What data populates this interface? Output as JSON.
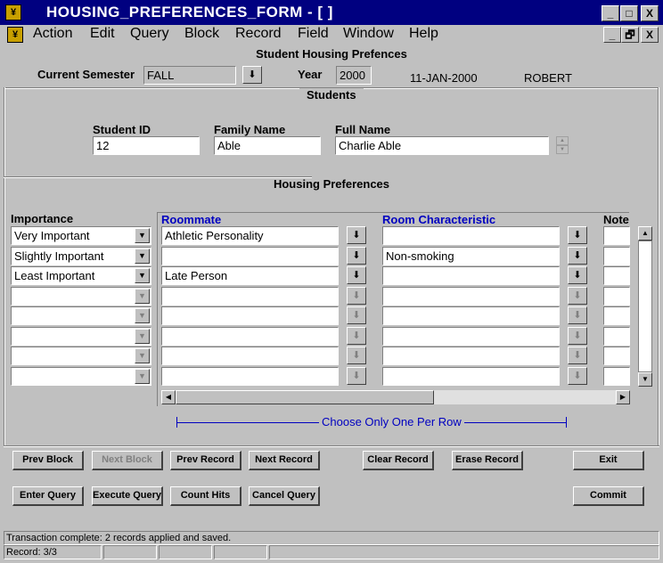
{
  "window": {
    "title": "HOUSING_PREFERENCES_FORM - [ ]",
    "icon": "oracle-forms-icon",
    "controls": {
      "minimize": "_",
      "maximize": "□",
      "close": "X",
      "restore": "🗗"
    }
  },
  "menu": [
    "Action",
    "Edit",
    "Query",
    "Block",
    "Record",
    "Field",
    "Window",
    "Help"
  ],
  "header": {
    "title": "Student Housing Prefences",
    "semester_label": "Current Semester",
    "semester_value": "FALL",
    "year_label": "Year",
    "year_value": "2000",
    "date": "11-JAN-2000",
    "user": "ROBERT"
  },
  "students": {
    "title": "Students",
    "id_label": "Student ID",
    "id_value": "12",
    "family_label": "Family Name",
    "family_value": "Able",
    "full_label": "Full Name",
    "full_value": "Charlie  Able"
  },
  "prefs": {
    "title": "Housing Preferences",
    "importance_label": "Importance",
    "roommate_label": "Roommate",
    "room_label": "Room Characteristic",
    "note_label": "Note",
    "rows": [
      {
        "importance": "Very Important",
        "roommate": "Athletic Personality",
        "room": ""
      },
      {
        "importance": "Slightly Important",
        "roommate": "",
        "room": "Non-smoking"
      },
      {
        "importance": "Least Important",
        "roommate": "Late Person",
        "room": ""
      },
      {
        "importance": "",
        "roommate": "",
        "room": ""
      },
      {
        "importance": "",
        "roommate": "",
        "room": ""
      },
      {
        "importance": "",
        "roommate": "",
        "room": ""
      },
      {
        "importance": "",
        "roommate": "",
        "room": ""
      },
      {
        "importance": "",
        "roommate": "",
        "room": ""
      }
    ],
    "choose_note": "Choose Only One Per Row"
  },
  "buttons": {
    "prev_block": "Prev Block",
    "next_block": "Next Block",
    "prev_record": "Prev Record",
    "next_record": "Next Record",
    "clear_record": "Clear Record",
    "erase_record": "Erase Record",
    "exit": "Exit",
    "enter_query": "Enter Query",
    "execute_query": "Execute Query",
    "count_hits": "Count Hits",
    "cancel_query": "Cancel Query",
    "commit": "Commit"
  },
  "status": {
    "message": "Transaction complete: 2 records applied and saved.",
    "record": "Record: 3/3"
  }
}
